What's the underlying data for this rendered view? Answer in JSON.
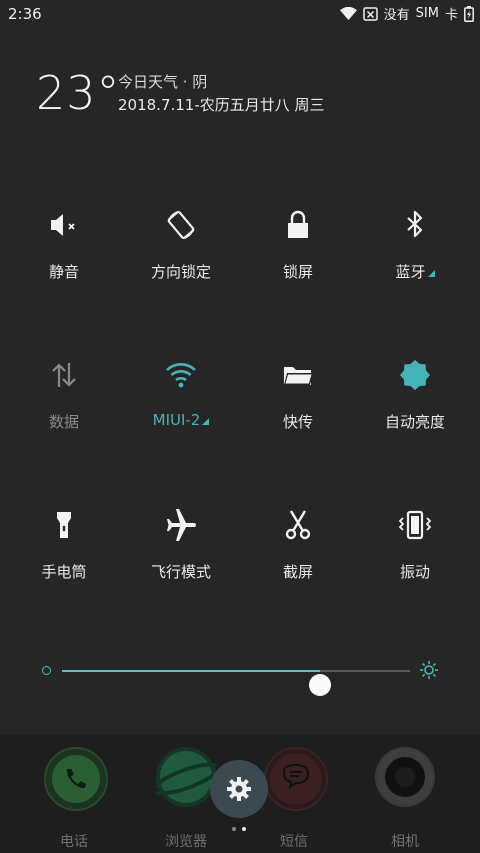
{
  "status": {
    "time": "2:36",
    "carrier1": "没有",
    "carrier2": "SIM",
    "carrier3": "卡"
  },
  "weather": {
    "temperature": "23°",
    "line1": "今日天气 · 阴",
    "line2": "2018.7.11-农历五月廿八 周三"
  },
  "tiles": [
    {
      "label": "静音",
      "icon": "mute-icon"
    },
    {
      "label": "方向锁定",
      "icon": "rotation-lock-icon"
    },
    {
      "label": "锁屏",
      "icon": "lock-icon"
    },
    {
      "label": "蓝牙",
      "icon": "bluetooth-icon"
    },
    {
      "label": "数据",
      "icon": "data-icon"
    },
    {
      "label": "MIUI-2",
      "icon": "wifi-icon"
    },
    {
      "label": "快传",
      "icon": "folder-icon"
    },
    {
      "label": "自动亮度",
      "icon": "auto-brightness-icon"
    },
    {
      "label": "手电筒",
      "icon": "flashlight-icon"
    },
    {
      "label": "飞行模式",
      "icon": "airplane-icon"
    },
    {
      "label": "截屏",
      "icon": "scissors-icon"
    },
    {
      "label": "振动",
      "icon": "vibrate-icon"
    }
  ],
  "brightness": {
    "level": 0.74
  },
  "dock": [
    {
      "label": "电话",
      "icon": "phone-icon"
    },
    {
      "label": "浏览器",
      "icon": "browser-icon"
    },
    {
      "label": "短信",
      "icon": "messages-icon"
    },
    {
      "label": "相机",
      "icon": "camera-icon"
    }
  ],
  "colors": {
    "accent": "#45b3b8",
    "background": "#262626"
  }
}
